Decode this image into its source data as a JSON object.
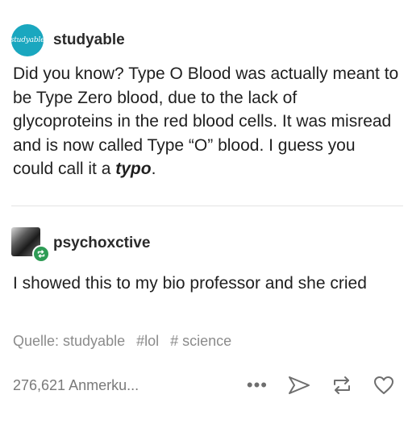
{
  "posts": [
    {
      "avatar_text": "studyable",
      "username": "studyable",
      "text_before": "Did you know? Type O Blood was actually meant to be Type Zero blood, due to the lack of glycoproteins in the red blood cells. It was misread and is now called Type “O” blood. I guess you could call it a ",
      "text_emphasis": "typo",
      "text_after": "."
    },
    {
      "username": "psychoxctive",
      "text": "I showed this to my bio professor and she cried"
    }
  ],
  "source": "Quelle: studyable",
  "tags": [
    "#lol",
    "# science"
  ],
  "footer": {
    "notes": "276,621 Anmerku...",
    "more": "•••"
  },
  "colors": {
    "studyable_avatar": "#1aa7bf",
    "reblog_badge": "#2e9b55",
    "muted_text": "#8b8b8b"
  },
  "icons": {
    "reblog_badge": "reblog-icon",
    "share": "share-icon",
    "reblog": "reblog-icon",
    "like": "heart-icon",
    "more": "more-icon"
  }
}
